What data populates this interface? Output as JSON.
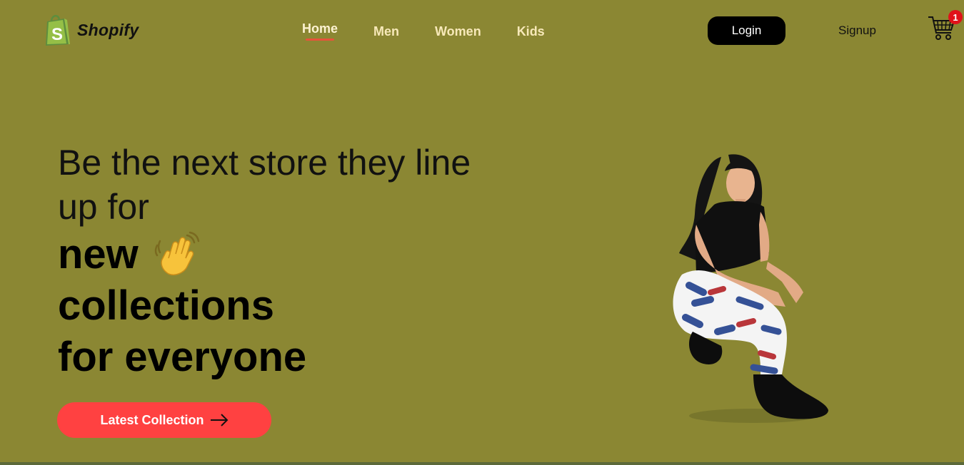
{
  "brand": {
    "name": "Shopify"
  },
  "nav": {
    "items": [
      {
        "label": "Home",
        "active": true
      },
      {
        "label": "Men",
        "active": false
      },
      {
        "label": "Women",
        "active": false
      },
      {
        "label": "Kids",
        "active": false
      }
    ]
  },
  "auth": {
    "login_label": "Login",
    "signup_label": "Signup"
  },
  "cart": {
    "count": "1",
    "icon": "shopping-cart-icon"
  },
  "hero": {
    "line1": "Be the next store they line up for",
    "line2": "new",
    "line3": "collections",
    "line4": "for everyone",
    "emoji_icon": "waving-hand-icon",
    "cta_label": "Latest Collection",
    "cta_icon": "arrow-right-icon"
  },
  "colors": {
    "background": "#8b8733",
    "accent": "#ff4141",
    "nav_text": "#f7e9b9",
    "badge": "#e0121a"
  }
}
